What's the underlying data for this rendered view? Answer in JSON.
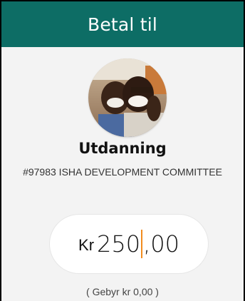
{
  "header": {
    "title": "Betal til"
  },
  "recipient": {
    "name": "Utdanning",
    "id_line": "#97983 ISHA DEVELOPMENT COMMITTEE",
    "avatar_icon": "recipient-photo"
  },
  "amount": {
    "currency": "Kr",
    "integer": "250",
    "decimal": ",00",
    "cursor_color": "#f28c1e"
  },
  "fee": {
    "text": "( Gebyr kr 0,00 )"
  },
  "colors": {
    "header_bg": "#0d6d65",
    "page_bg": "#f3f3f3"
  }
}
